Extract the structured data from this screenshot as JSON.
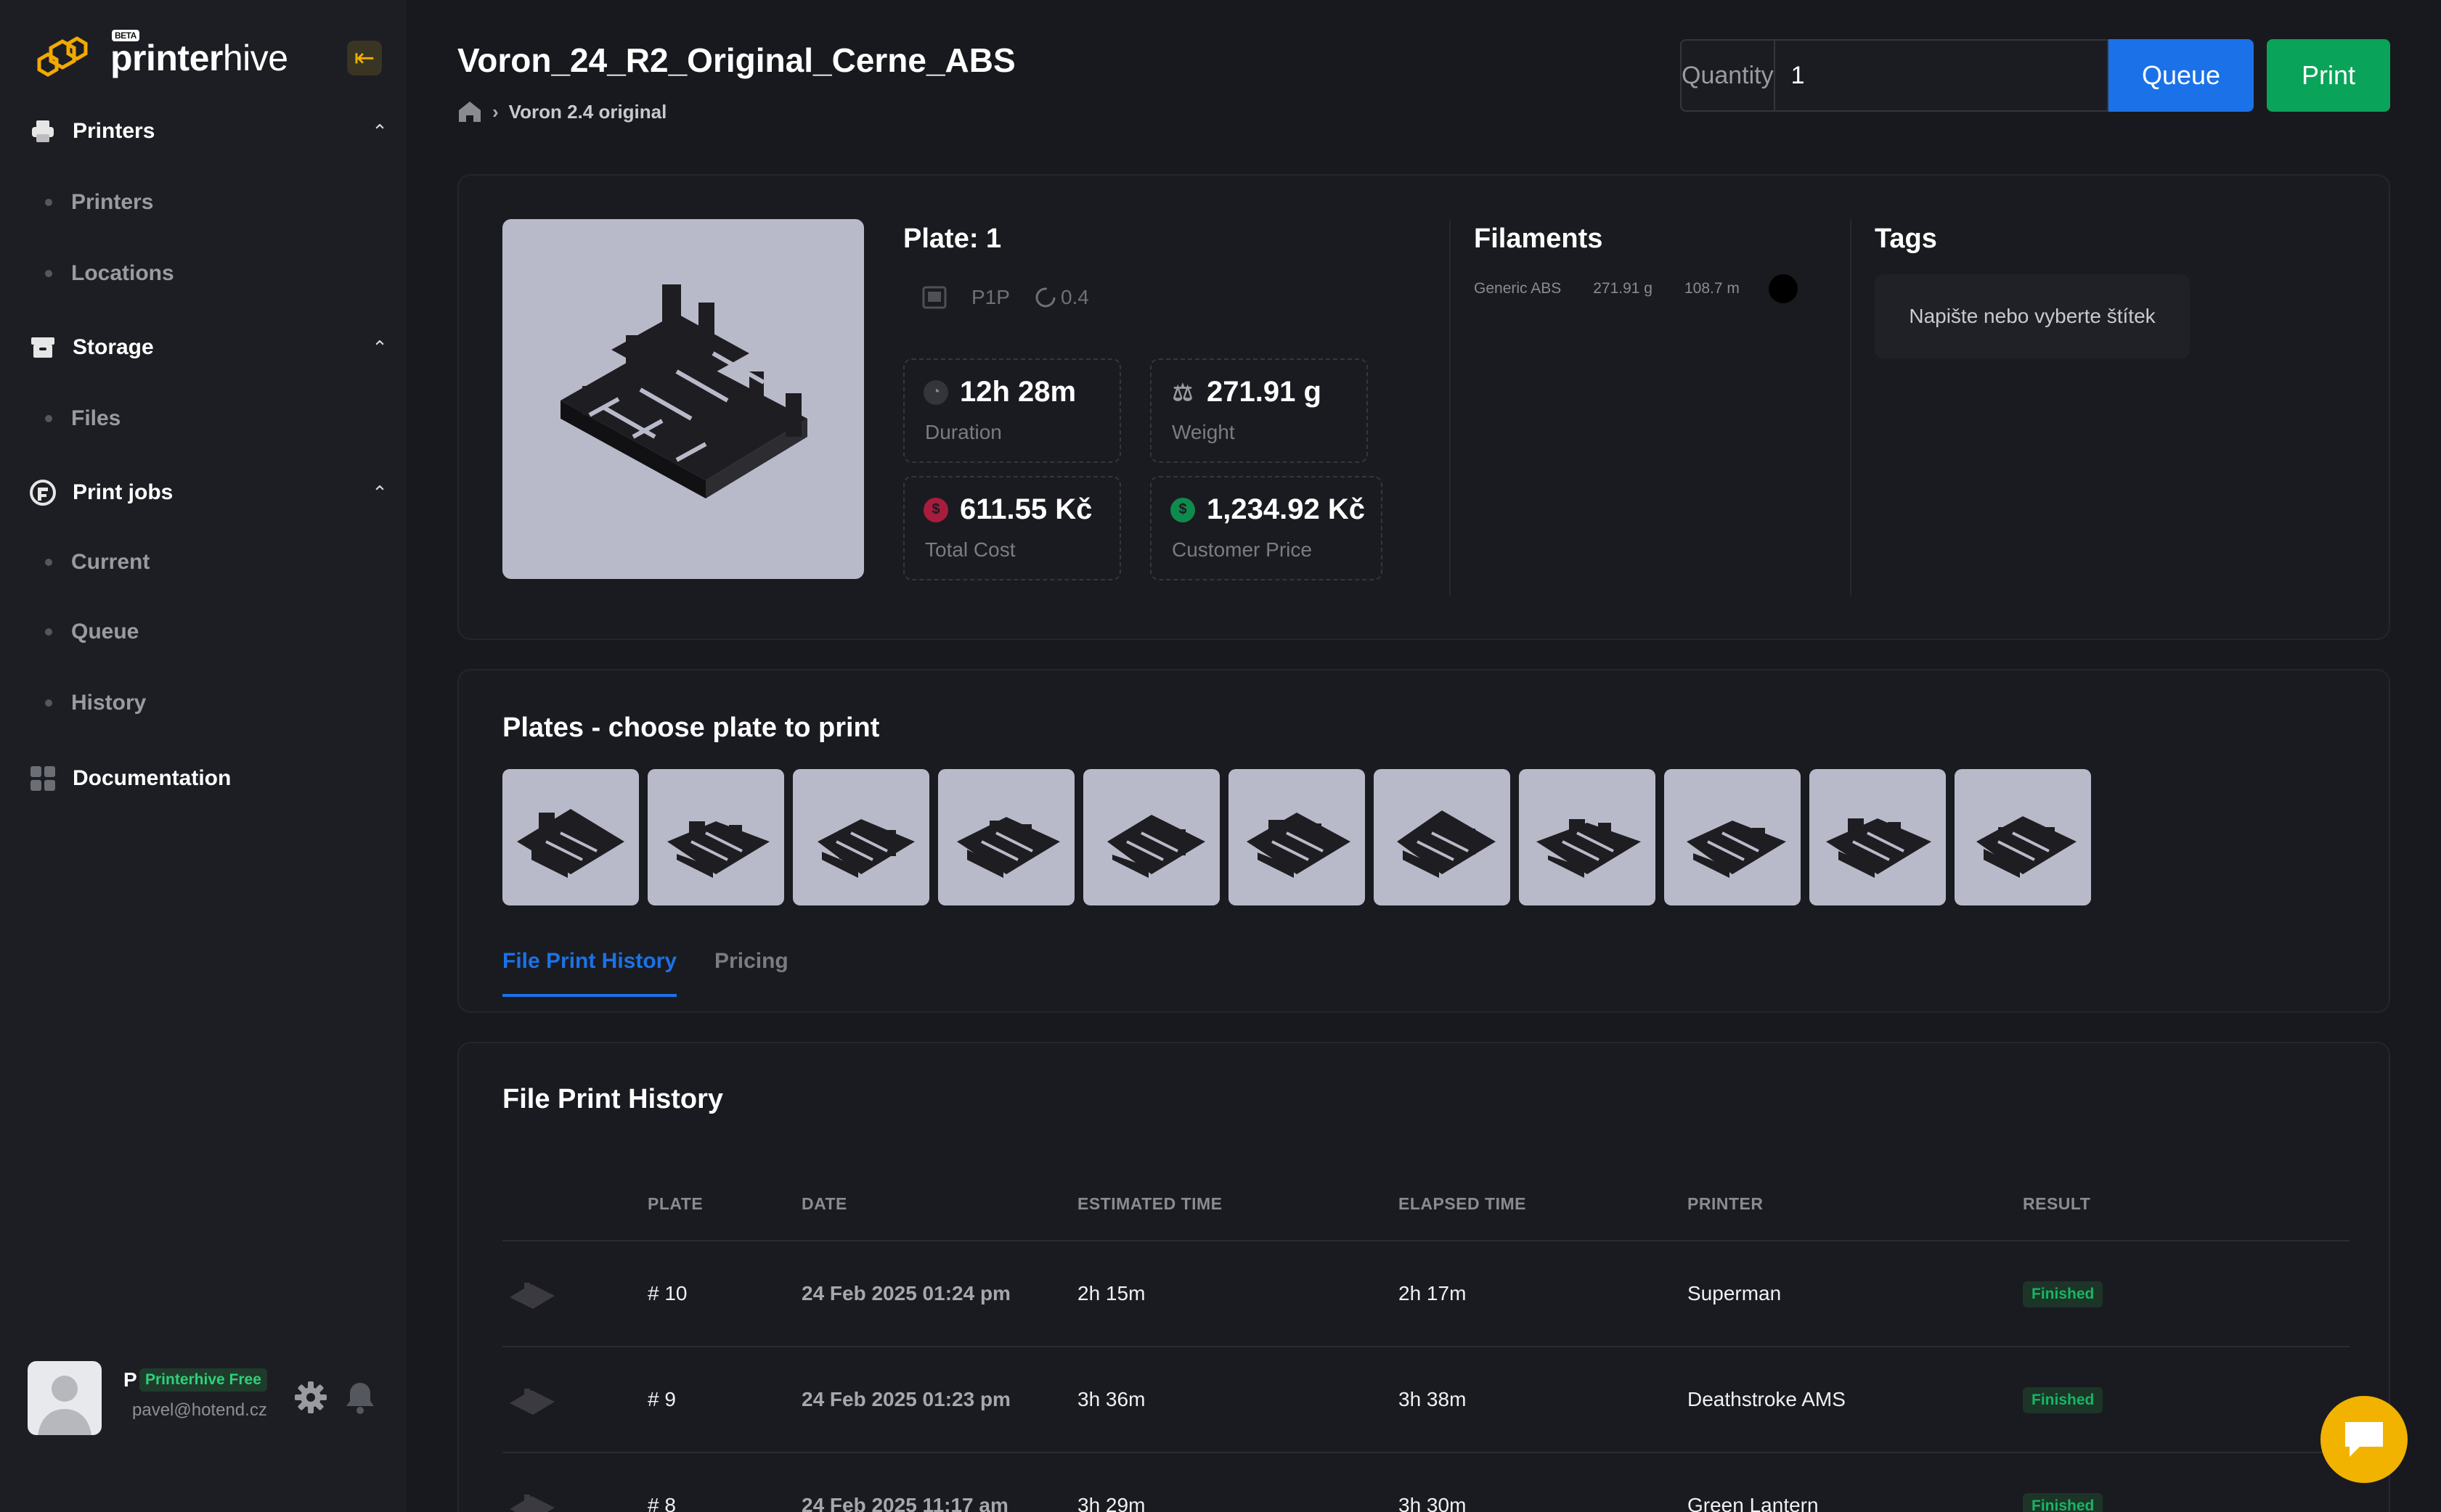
{
  "brand": {
    "name_prefix": "printer",
    "name_suffix": "hive",
    "badge": "BETA"
  },
  "sidebar": {
    "sections": [
      {
        "label": "Printers",
        "items": [
          "Printers",
          "Locations"
        ]
      },
      {
        "label": "Storage",
        "items": [
          "Files"
        ]
      },
      {
        "label": "Print jobs",
        "items": [
          "Current",
          "Queue",
          "History"
        ]
      }
    ],
    "documentation": "Documentation",
    "user": {
      "initial": "P",
      "plan": "Printerhive Free",
      "email": "pavel@hotend.cz"
    }
  },
  "header": {
    "title": "Voron_24_R2_Original_Cerne_ABS",
    "breadcrumb": "Voron 2.4 original",
    "quantity_label": "Quantity",
    "quantity_value": "1",
    "queue_label": "Queue",
    "print_label": "Print"
  },
  "plate": {
    "title": "Plate: 1",
    "printer": "P1P",
    "nozzle": "0.4",
    "duration": "12h 28m",
    "duration_label": "Duration",
    "weight": "271.91 g",
    "weight_label": "Weight",
    "total_cost": "611.55 Kč",
    "total_cost_label": "Total Cost",
    "customer_price": "1,234.92 Kč",
    "customer_price_label": "Customer Price"
  },
  "filaments": {
    "title": "Filaments",
    "items": [
      {
        "name": "Generic ABS",
        "weight": "271.91 g",
        "length": "108.7 m",
        "color": "#000000"
      }
    ]
  },
  "tags": {
    "title": "Tags",
    "placeholder": "Napište nebo vyberte štítek"
  },
  "plates": {
    "title": "Plates - choose plate to print",
    "count": 11
  },
  "tabs": [
    "File Print History",
    "Pricing"
  ],
  "history": {
    "title": "File Print History",
    "columns": [
      "PLATE",
      "DATE",
      "ESTIMATED TIME",
      "ELAPSED TIME",
      "PRINTER",
      "RESULT"
    ],
    "rows": [
      {
        "plate": "# 10",
        "date": "24 Feb 2025 01:24 pm",
        "estimated": "2h 15m",
        "elapsed": "2h 17m",
        "printer": "Superman",
        "result": "Finished"
      },
      {
        "plate": "# 9",
        "date": "24 Feb 2025 01:23 pm",
        "estimated": "3h 36m",
        "elapsed": "3h 38m",
        "printer": "Deathstroke AMS",
        "result": "Finished"
      },
      {
        "plate": "# 8",
        "date": "24 Feb 2025 11:17 am",
        "estimated": "3h 29m",
        "elapsed": "3h 30m",
        "printer": "Green Lantern",
        "result": "Finished"
      }
    ]
  },
  "colors": {
    "accent_blue": "#1b72e8",
    "print_green": "#0aa35a",
    "brand_yellow": "#f2b200",
    "success": "#17b565"
  }
}
